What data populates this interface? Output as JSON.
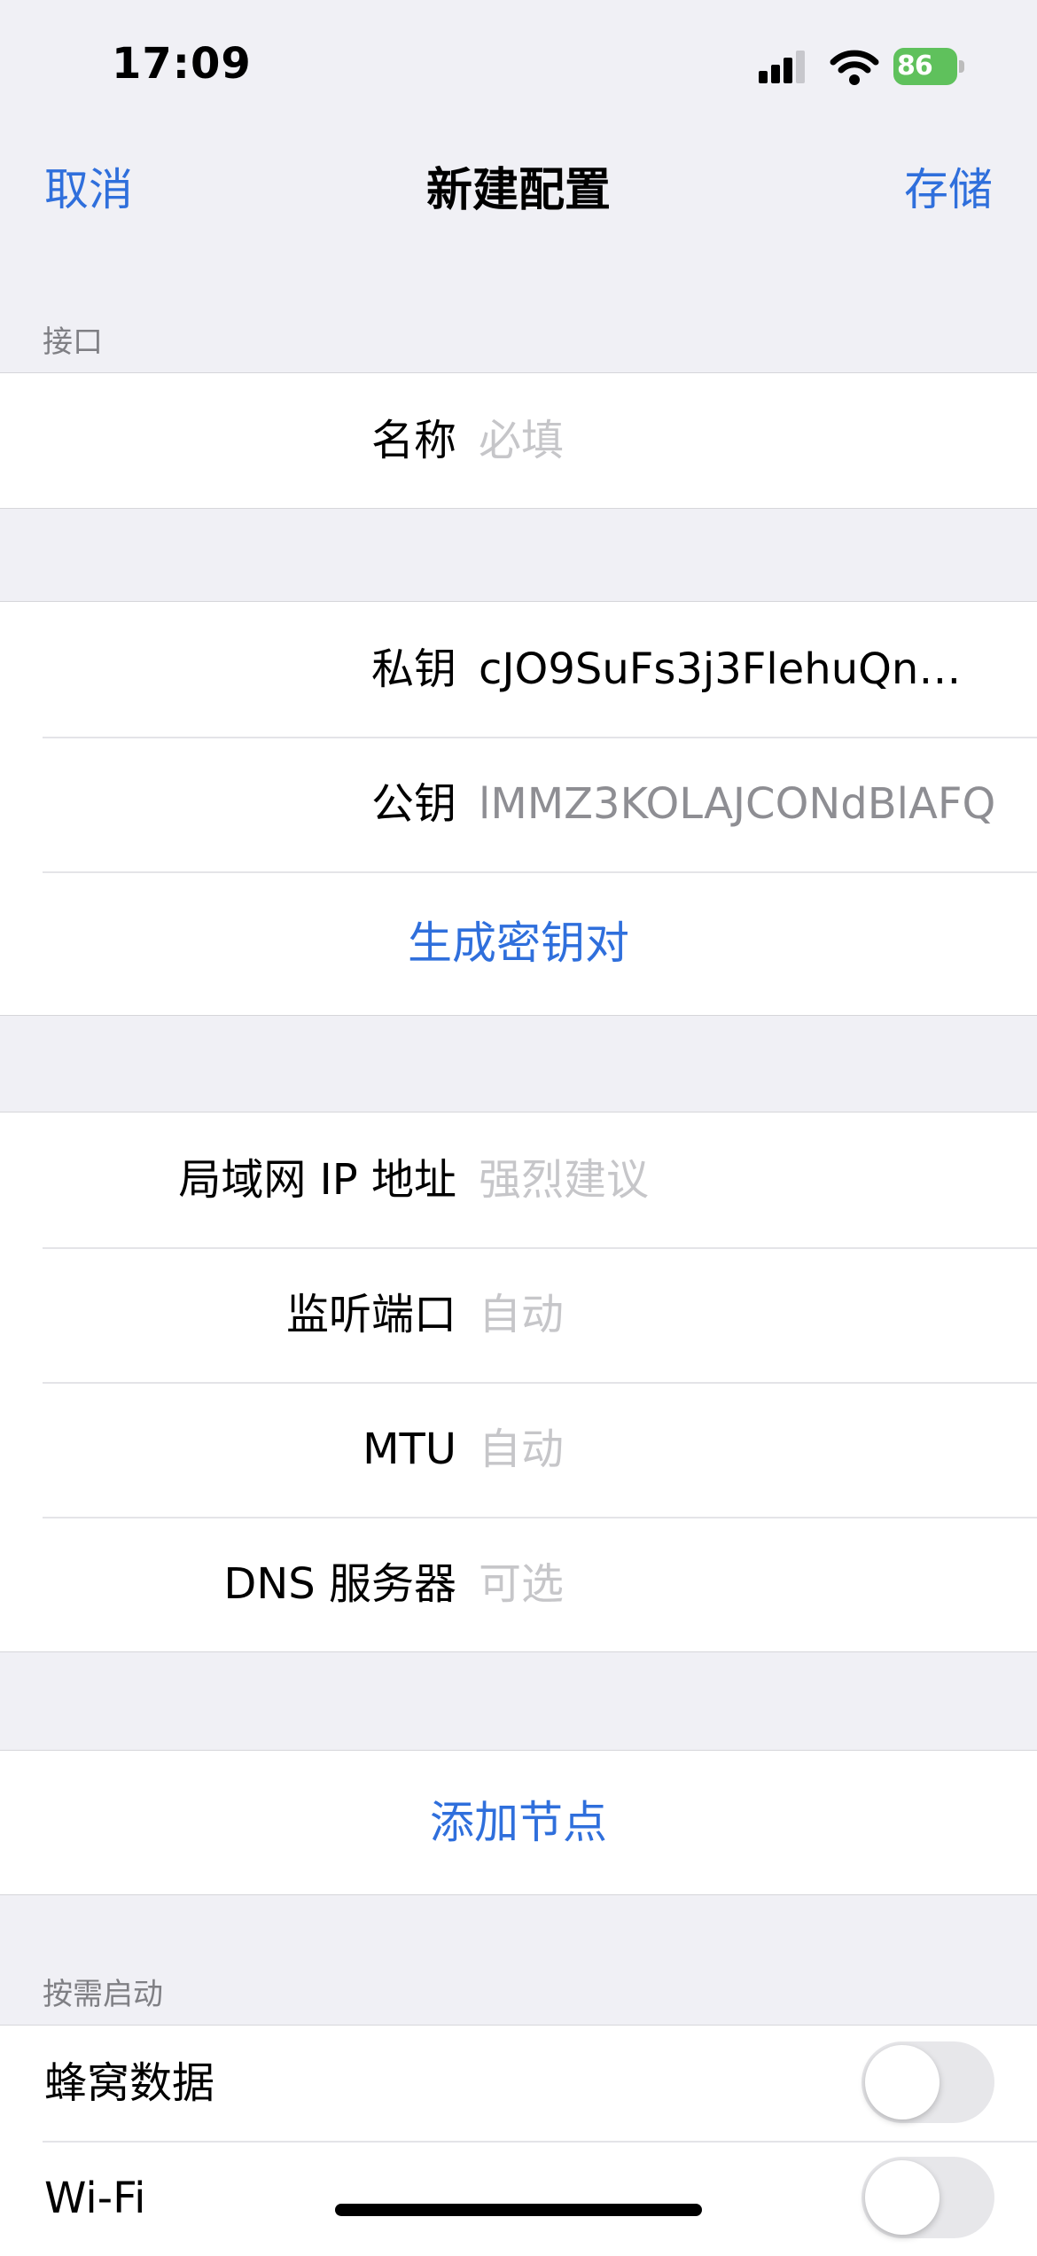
{
  "status": {
    "time": "17:09",
    "battery": "86"
  },
  "nav": {
    "cancel": "取消",
    "title": "新建配置",
    "save": "存储"
  },
  "interface": {
    "header": "接口",
    "name": {
      "label": "名称",
      "placeholder": "必填"
    },
    "private_key": {
      "label": "私钥",
      "value": "cJO9SuFs3j3FlehuQn+5..."
    },
    "public_key": {
      "label": "公钥",
      "value": "lMMZ3KOLAJCONdBlAFQv"
    },
    "generate": "生成密钥对",
    "addresses": {
      "label": "局域网 IP 地址",
      "placeholder": "强烈建议"
    },
    "listen_port": {
      "label": "监听端口",
      "placeholder": "自动"
    },
    "mtu": {
      "label": "MTU",
      "placeholder": "自动"
    },
    "dns": {
      "label": "DNS 服务器",
      "placeholder": "可选"
    }
  },
  "add_peer": "添加节点",
  "on_demand": {
    "header": "按需启动",
    "cellular": {
      "label": "蜂窝数据",
      "on": false
    },
    "wifi": {
      "label": "Wi-Fi",
      "on": false
    }
  },
  "colors": {
    "accent": "#2f6fdc",
    "battery": "#5fc15c",
    "background": "#f0f0f5"
  }
}
